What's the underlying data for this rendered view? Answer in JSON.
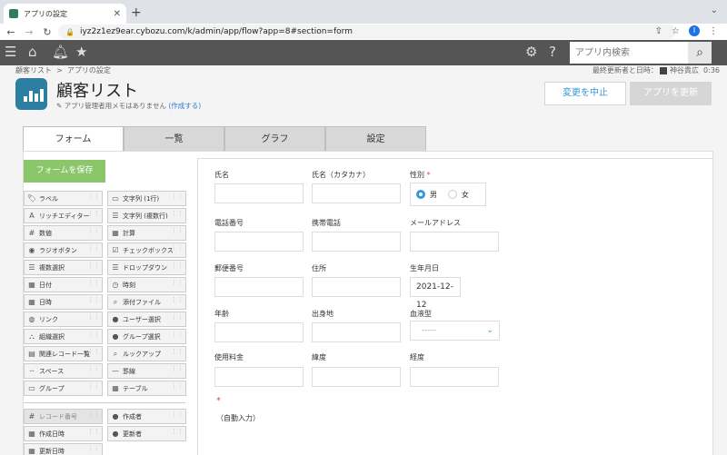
{
  "browser": {
    "tab_title": "アプリの設定",
    "url": "iyz2z1ez9ear.cybozu.com/k/admin/app/flow?app=8#section=form"
  },
  "header": {
    "search_placeholder": "アプリ内検索"
  },
  "breadcrumb": {
    "root": "顧客リスト",
    "sep": ">",
    "current": "アプリの設定"
  },
  "last_updated": {
    "label": "最終更新者と日時：",
    "user": "神谷貴広",
    "time": "0:36"
  },
  "app": {
    "name": "顧客リスト",
    "memo": "アプリ管理者用メモはありません",
    "memo_link": "(作成する)"
  },
  "actions": {
    "cancel": "変更を中止",
    "update": "アプリを更新"
  },
  "tabs": [
    "フォーム",
    "一覧",
    "グラフ",
    "設定"
  ],
  "palette": {
    "save": "フォームを保存",
    "items": [
      {
        "label": "ラベル",
        "icon": "🏷"
      },
      {
        "label": "文字列 (1行)",
        "icon": "▭"
      },
      {
        "label": "リッチエディター",
        "icon": "A"
      },
      {
        "label": "文字列 (複数行)",
        "icon": "☰"
      },
      {
        "label": "数値",
        "icon": "#"
      },
      {
        "label": "計算",
        "icon": "▦"
      },
      {
        "label": "ラジオボタン",
        "icon": "◉"
      },
      {
        "label": "チェックボックス",
        "icon": "☑"
      },
      {
        "label": "複数選択",
        "icon": "☰"
      },
      {
        "label": "ドロップダウン",
        "icon": "☰"
      },
      {
        "label": "日付",
        "icon": "▦"
      },
      {
        "label": "時刻",
        "icon": "◷"
      },
      {
        "label": "日時",
        "icon": "▦"
      },
      {
        "label": "添付ファイル",
        "icon": "⌕"
      },
      {
        "label": "リンク",
        "icon": "◍"
      },
      {
        "label": "ユーザー選択",
        "icon": "●"
      },
      {
        "label": "組織選択",
        "icon": "⛬"
      },
      {
        "label": "グループ選択",
        "icon": "●"
      },
      {
        "label": "関連レコード一覧",
        "icon": "▤"
      },
      {
        "label": "ルックアップ",
        "icon": "⌕"
      },
      {
        "label": "スペース",
        "icon": "┄"
      },
      {
        "label": "罫線",
        "icon": "—"
      },
      {
        "label": "グループ",
        "icon": "▭"
      },
      {
        "label": "テーブル",
        "icon": "▦"
      }
    ],
    "system_items": [
      {
        "label": "レコード番号",
        "icon": "#"
      },
      {
        "label": "作成者",
        "icon": "●"
      },
      {
        "label": "作成日時",
        "icon": "▦"
      },
      {
        "label": "更新者",
        "icon": "●"
      },
      {
        "label": "更新日時",
        "icon": "▦"
      }
    ]
  },
  "form": {
    "name": "氏名",
    "name_kana": "氏名（カタカナ）",
    "gender": "性別",
    "gender_required": "*",
    "gender_options": [
      "男",
      "女"
    ],
    "phone": "電話番号",
    "mobile": "携帯電話",
    "email": "メールアドレス",
    "postal": "郵便番号",
    "address": "住所",
    "birthday": "生年月日",
    "birthday_value": "2021-12-12",
    "age": "年齢",
    "birthplace": "出身地",
    "blood_type": "血液型",
    "blood_type_value": "-----",
    "fee": "使用料金",
    "latitude": "緯度",
    "longitude": "経度",
    "auto_required": "*",
    "auto_input": "（自動入力）"
  }
}
